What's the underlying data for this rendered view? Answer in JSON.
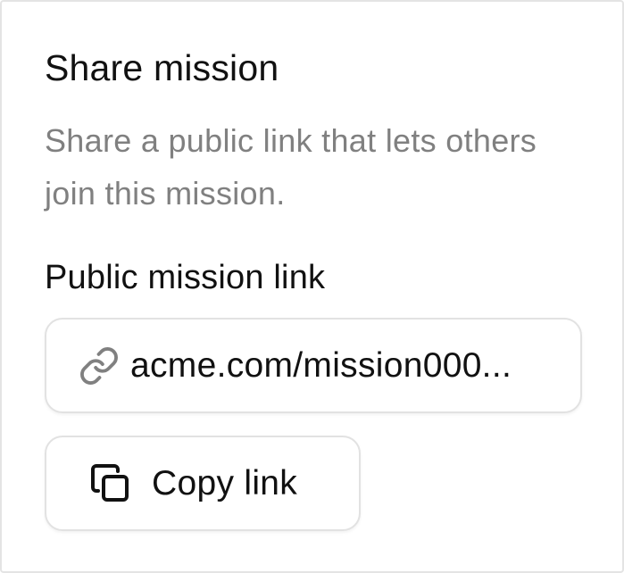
{
  "dialog": {
    "title": "Share mission",
    "description": "Share a public link that lets others join this mission."
  },
  "link_field": {
    "label": "Public mission link",
    "value": "acme.com/mission000...",
    "icon": "link-icon"
  },
  "copy_button": {
    "label": "Copy link",
    "icon": "copy-icon"
  },
  "colors": {
    "text_primary": "#111111",
    "text_muted": "#808080",
    "border": "#e2e2e2",
    "icon_link": "#808080"
  }
}
